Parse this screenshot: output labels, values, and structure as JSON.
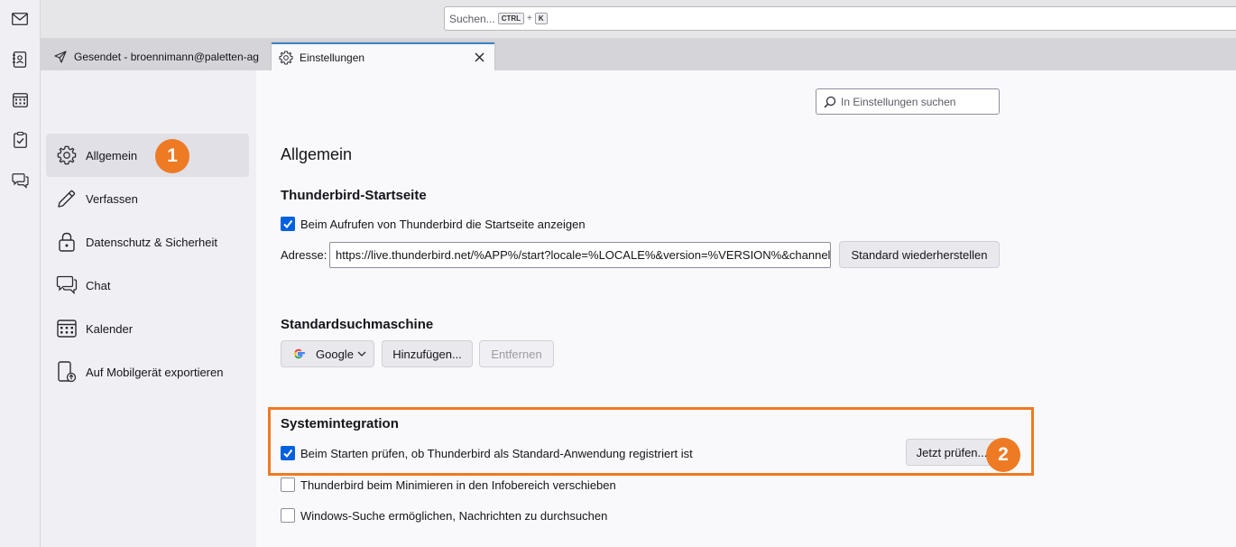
{
  "spaces": {
    "items": [
      {
        "name": "mail-icon"
      },
      {
        "name": "address-book-icon"
      },
      {
        "name": "calendar-icon"
      },
      {
        "name": "tasks-icon"
      },
      {
        "name": "chat-icon"
      }
    ]
  },
  "search": {
    "placeholder": "Suchen...",
    "shortcut_key1": "CTRL",
    "shortcut_plus": "+",
    "shortcut_key2": "K"
  },
  "tabs": [
    {
      "label": "Gesendet - broennimann@paletten-ag",
      "icon": "send-icon",
      "active": false
    },
    {
      "label": "Einstellungen",
      "icon": "gear-icon",
      "active": true
    }
  ],
  "sidebar": {
    "items": [
      {
        "label": "Allgemein",
        "icon": "gear-icon",
        "selected": true
      },
      {
        "label": "Verfassen",
        "icon": "pencil-icon",
        "selected": false
      },
      {
        "label": "Datenschutz & Sicherheit",
        "icon": "lock-icon",
        "selected": false
      },
      {
        "label": "Chat",
        "icon": "chat-icon",
        "selected": false
      },
      {
        "label": "Kalender",
        "icon": "calendar-icon",
        "selected": false
      },
      {
        "label": "Auf Mobilgerät exportieren",
        "icon": "mobile-export-icon",
        "selected": false
      }
    ]
  },
  "prefs_search": {
    "placeholder": "In Einstellungen suchen"
  },
  "page": {
    "title": "Allgemein"
  },
  "startpage": {
    "heading": "Thunderbird-Startseite",
    "show_label": "Beim Aufrufen von Thunderbird die Startseite anzeigen",
    "show_checked": true,
    "address_label": "Adresse:",
    "address_value": "https://live.thunderbird.net/%APP%/start?locale=%LOCALE%&version=%VERSION%&channel=",
    "restore_label": "Standard wiederherstellen"
  },
  "searchengine": {
    "heading": "Standardsuchmaschine",
    "selected": "Google",
    "add_label": "Hinzufügen...",
    "remove_label": "Entfernen"
  },
  "system": {
    "heading": "Systemintegration",
    "check_default_label": "Beim Starten prüfen, ob Thunderbird als Standard-Anwendung registriert ist",
    "check_default_checked": true,
    "check_now_label": "Jetzt prüfen...",
    "minimize_label": "Thunderbird beim Minimieren in den Infobereich verschieben",
    "minimize_checked": false,
    "windows_search_label": "Windows-Suche ermöglichen, Nachrichten zu durchsuchen",
    "windows_search_checked": false
  },
  "annotations": {
    "badge1": "1",
    "badge2": "2",
    "accent_color": "#ee7a24"
  }
}
